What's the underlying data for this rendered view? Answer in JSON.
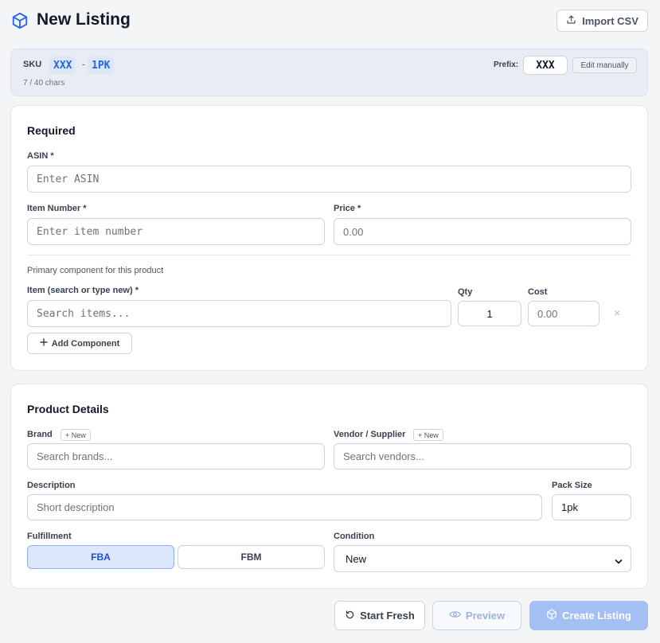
{
  "header": {
    "title": "New Listing",
    "import_label": "Import CSV"
  },
  "sku": {
    "label": "SKU",
    "part_prefix": "XXX",
    "separator": "-",
    "part_pack": "1PK",
    "char_count": "7 / 40 chars",
    "prefix_label": "Prefix:",
    "prefix_value": "XXX",
    "edit_manually": "Edit manually"
  },
  "required": {
    "title": "Required",
    "asin_label": "ASIN *",
    "asin_placeholder": "Enter ASIN",
    "item_number_label": "Item Number *",
    "item_number_placeholder": "Enter item number",
    "price_label": "Price *",
    "price_placeholder": "0.00",
    "component_hint": "Primary component for this product",
    "item_label": "Item (search or type new) *",
    "item_placeholder": "Search items...",
    "qty_label": "Qty",
    "qty_value": "1",
    "cost_label": "Cost",
    "cost_placeholder": "0.00",
    "remove_glyph": "×",
    "add_component": "Add Component"
  },
  "details": {
    "title": "Product Details",
    "brand_label": "Brand",
    "brand_new": "+ New",
    "brand_placeholder": "Search brands...",
    "vendor_label": "Vendor / Supplier",
    "vendor_new": "+ New",
    "vendor_placeholder": "Search vendors...",
    "description_label": "Description",
    "description_placeholder": "Short description",
    "pack_size_label": "Pack Size",
    "pack_size_value": "1pk",
    "fulfillment_label": "Fulfillment",
    "fulfillment_options": [
      "FBA",
      "FBM"
    ],
    "condition_label": "Condition",
    "condition_value": "New"
  },
  "footer": {
    "start_fresh": "Start Fresh",
    "preview": "Preview",
    "create": "Create Listing"
  },
  "colors": {
    "accent": "#2563eb",
    "active_toggle_bg": "#dde7fb",
    "disabled_primary": "#a3bff3"
  },
  "icons": [
    "cube-icon",
    "upload-icon",
    "plus-icon",
    "refresh-icon",
    "eye-icon",
    "chevron-down-icon",
    "close-icon"
  ]
}
